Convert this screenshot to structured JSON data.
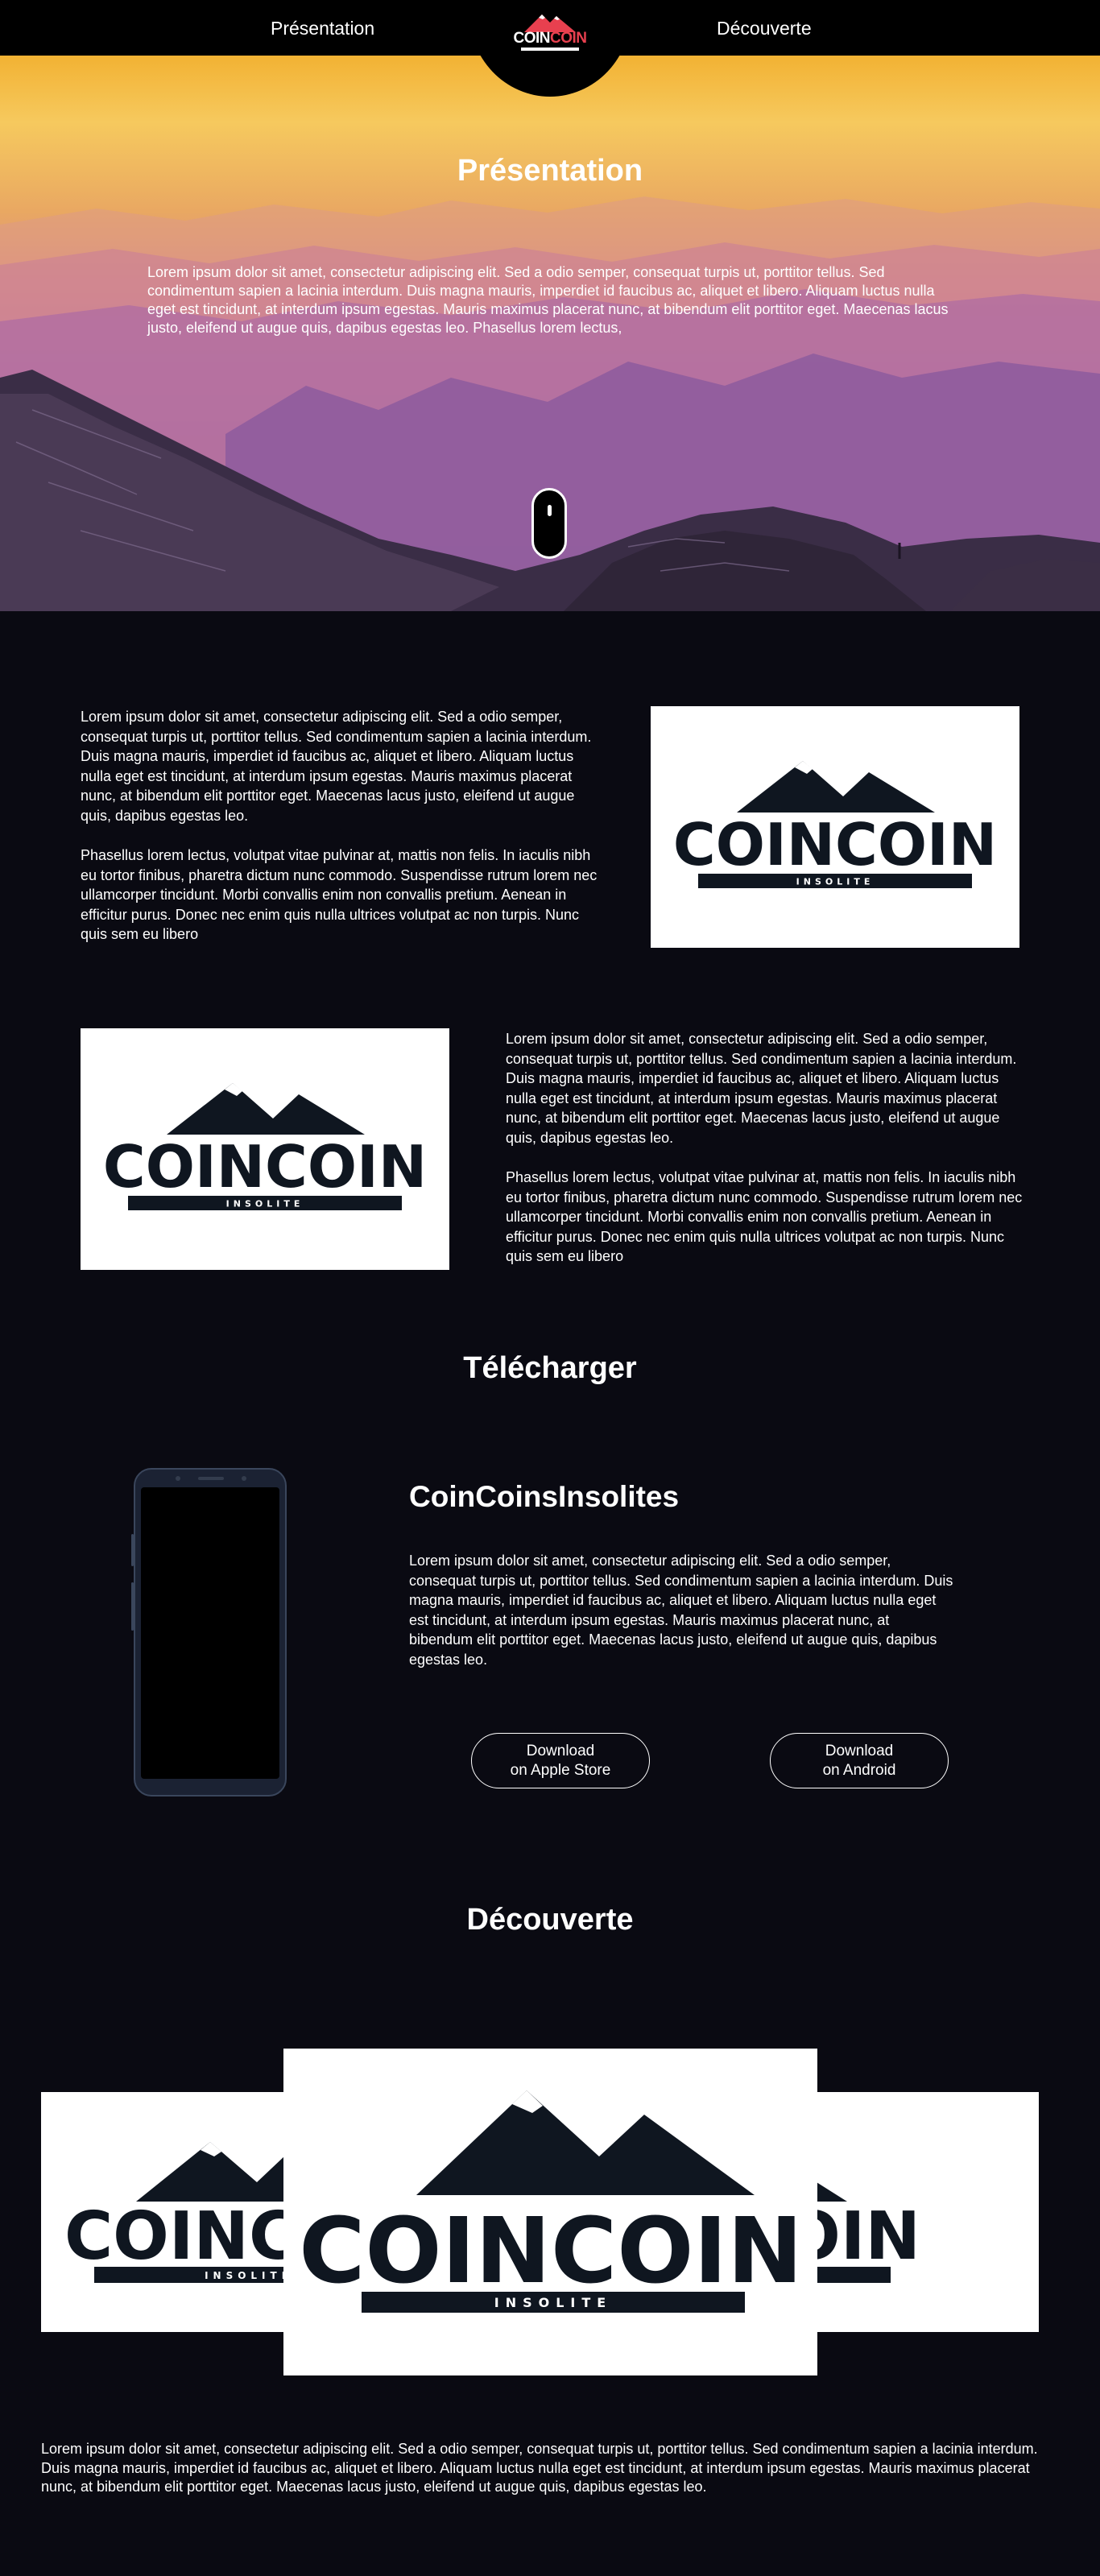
{
  "nav": {
    "left_link": "Présentation",
    "right_link": "Découverte",
    "logo": {
      "word1": "COIN",
      "word2": "COIN",
      "icon": "mountain-logo-icon"
    }
  },
  "hero": {
    "title": "Présentation",
    "text": "Lorem ipsum dolor sit amet, consectetur adipiscing elit. Sed a odio semper, consequat turpis ut, porttitor tellus. Sed condimentum sapien a lacinia interdum. Duis magna mauris, imperdiet id faucibus ac, aliquet et libero. Aliquam luctus nulla eget est tincidunt, at interdum ipsum egestas. Mauris maximus placerat nunc, at bibendum elit porttitor eget. Maecenas lacus justo, eleifend ut augue quis, dapibus egestas leo. Phasellus lorem lectus,",
    "scroll_icon": "scroll-mouse-icon"
  },
  "about": {
    "block1": {
      "p1": "Lorem ipsum dolor sit amet, consectetur adipiscing elit. Sed a odio semper, consequat turpis ut, porttitor tellus. Sed condimentum sapien a lacinia interdum. Duis magna mauris, imperdiet id faucibus ac, aliquet et libero. Aliquam luctus nulla eget est tincidunt, at interdum ipsum egestas. Mauris maximus placerat nunc, at bibendum elit porttitor eget. Maecenas lacus justo, eleifend ut augue quis, dapibus egestas leo.",
      "p2": "Phasellus lorem lectus, volutpat vitae pulvinar at, mattis non felis. In iaculis nibh eu tortor finibus, pharetra dictum nunc commodo. Suspendisse rutrum lorem nec ullamcorper tincidunt. Morbi convallis enim non convallis pretium. Aenean in efficitur purus. Donec nec enim quis nulla ultrices volutpat ac non turpis. Nunc quis sem eu libero"
    },
    "block2": {
      "p1": "Lorem ipsum dolor sit amet, consectetur adipiscing elit. Sed a odio semper, consequat turpis ut, porttitor tellus. Sed condimentum sapien a lacinia interdum. Duis magna mauris, imperdiet id faucibus ac, aliquet et libero. Aliquam luctus nulla eget est tincidunt, at interdum ipsum egestas. Mauris maximus placerat nunc, at bibendum elit porttitor eget. Maecenas lacus justo, eleifend ut augue quis, dapibus egestas leo.",
      "p2": "Phasellus lorem lectus, volutpat vitae pulvinar at, mattis non felis. In iaculis nibh eu tortor finibus, pharetra dictum nunc commodo. Suspendisse rutrum lorem nec ullamcorper tincidunt. Morbi convallis enim non convallis pretium. Aenean in efficitur purus. Donec nec enim quis nulla ultrices volutpat ac non turpis. Nunc quis sem eu libero"
    },
    "logo": {
      "word": "COINCOIN",
      "tagline": "INSOLITE"
    }
  },
  "download": {
    "title": "Télécharger",
    "app_name": "CoinCoinsInsolites",
    "description": "Lorem ipsum dolor sit amet, consectetur adipiscing elit. Sed a odio semper, consequat turpis ut, porttitor tellus. Sed condimentum sapien a lacinia interdum. Duis magna mauris, imperdiet id faucibus ac, aliquet et libero. Aliquam luctus nulla eget est tincidunt, at interdum ipsum egestas. Mauris maximus placerat nunc, at bibendum elit porttitor eget. Maecenas lacus justo, eleifend ut augue quis, dapibus egestas leo.",
    "apple_btn": {
      "line1": "Download",
      "line2": "on Apple Store"
    },
    "android_btn": {
      "line1": "Download",
      "line2": "on Android"
    }
  },
  "discover": {
    "title": "Découverte",
    "text": "Lorem ipsum dolor sit amet, consectetur adipiscing elit. Sed a odio semper, consequat turpis ut, porttitor tellus. Sed condimentum sapien a lacinia interdum. Duis magna mauris, imperdiet id faucibus ac, aliquet et libero. Aliquam luctus nulla eget est tincidunt, at interdum ipsum egestas. Mauris maximus placerat nunc, at bibendum elit porttitor eget. Maecenas lacus justo, eleifend ut augue quis, dapibus egestas leo."
  },
  "colors": {
    "background": "#0a0a12",
    "accent_red": "#e8404f",
    "logo_dark": "#0f1620"
  }
}
